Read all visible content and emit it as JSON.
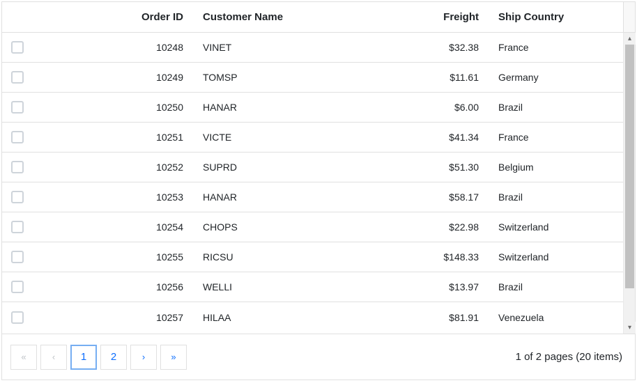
{
  "columns": {
    "order_id": "Order ID",
    "customer_name": "Customer Name",
    "freight": "Freight",
    "ship_country": "Ship Country"
  },
  "rows": [
    {
      "order_id": "10248",
      "customer_name": "VINET",
      "freight": "$32.38",
      "ship_country": "France"
    },
    {
      "order_id": "10249",
      "customer_name": "TOMSP",
      "freight": "$11.61",
      "ship_country": "Germany"
    },
    {
      "order_id": "10250",
      "customer_name": "HANAR",
      "freight": "$6.00",
      "ship_country": "Brazil"
    },
    {
      "order_id": "10251",
      "customer_name": "VICTE",
      "freight": "$41.34",
      "ship_country": "France"
    },
    {
      "order_id": "10252",
      "customer_name": "SUPRD",
      "freight": "$51.30",
      "ship_country": "Belgium"
    },
    {
      "order_id": "10253",
      "customer_name": "HANAR",
      "freight": "$58.17",
      "ship_country": "Brazil"
    },
    {
      "order_id": "10254",
      "customer_name": "CHOPS",
      "freight": "$22.98",
      "ship_country": "Switzerland"
    },
    {
      "order_id": "10255",
      "customer_name": "RICSU",
      "freight": "$148.33",
      "ship_country": "Switzerland"
    },
    {
      "order_id": "10256",
      "customer_name": "WELLI",
      "freight": "$13.97",
      "ship_country": "Brazil"
    },
    {
      "order_id": "10257",
      "customer_name": "HILAA",
      "freight": "$81.91",
      "ship_country": "Venezuela"
    }
  ],
  "pager": {
    "pages": [
      "1",
      "2"
    ],
    "current": "1",
    "info": "1 of 2 pages (20 items)"
  }
}
